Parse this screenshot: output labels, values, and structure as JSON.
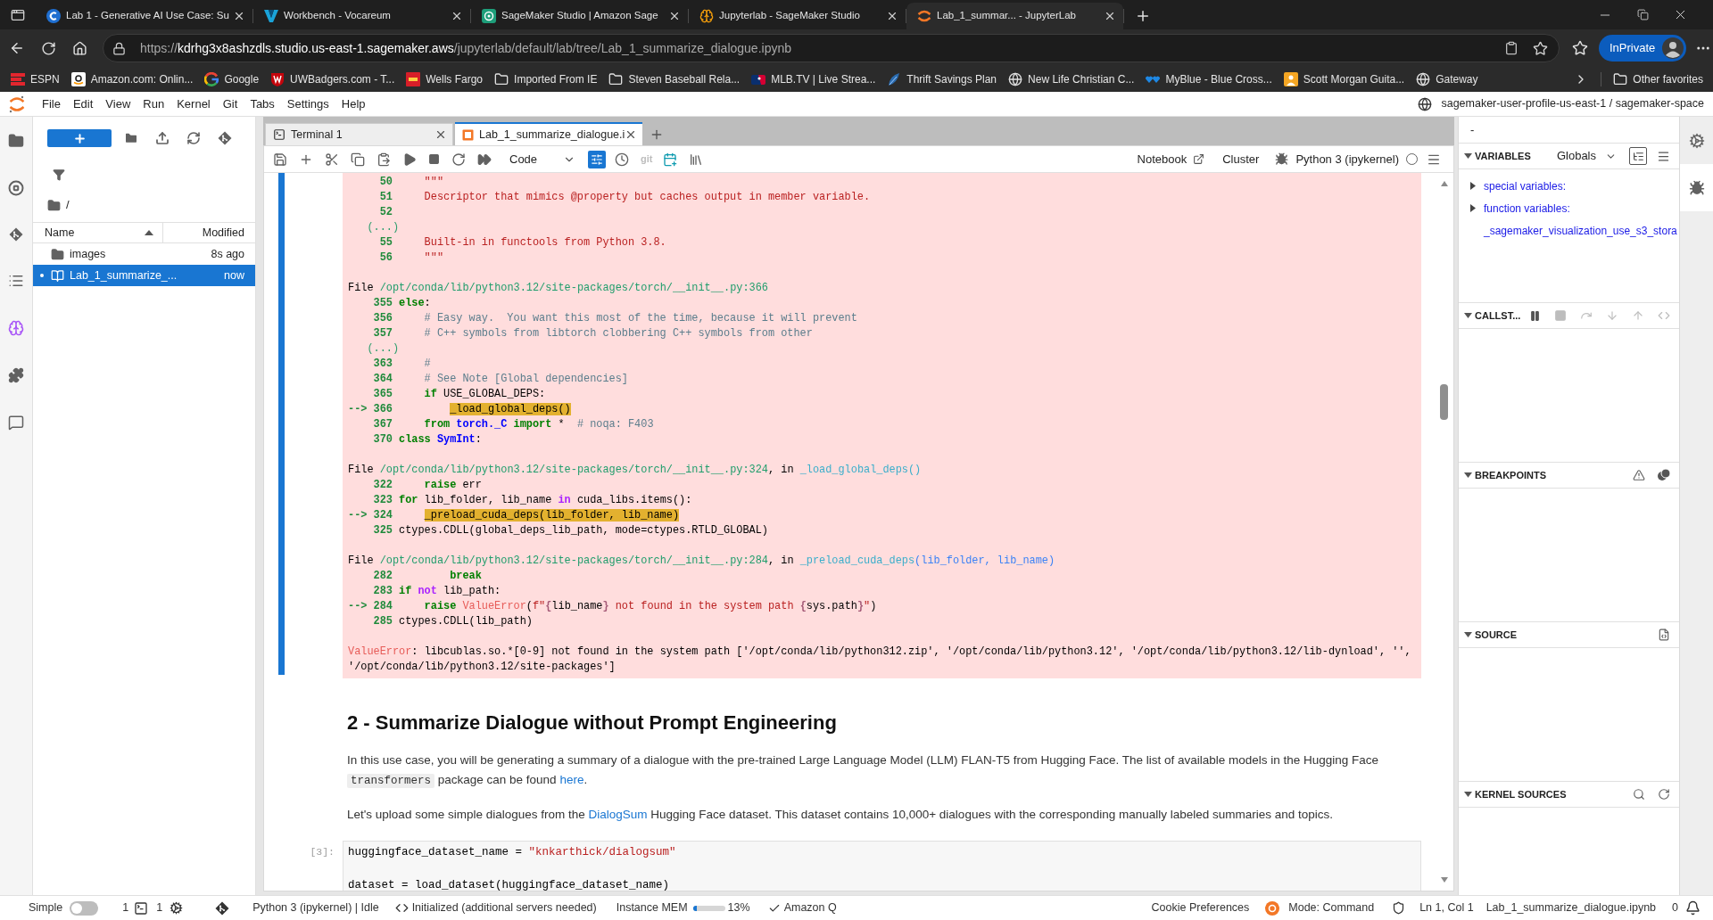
{
  "browser": {
    "tabs": [
      {
        "title": "Lab 1 - Generative AI Use Case: Su",
        "kind": "course",
        "selected": false
      },
      {
        "title": "Workbench - Vocareum",
        "kind": "workbench",
        "selected": false
      },
      {
        "title": "SageMaker Studio | Amazon Sage",
        "kind": "studio",
        "selected": false
      },
      {
        "title": "Jupyterlab - SageMaker Studio",
        "kind": "brain",
        "selected": false
      },
      {
        "title": "Lab_1_summar... - JupyterLab",
        "kind": "jupyter",
        "selected": true
      }
    ],
    "address": {
      "scheme": "https://",
      "host": "kdrhg3x8ashzdls.studio.us-east-1.sagemaker.aws",
      "path": "/jupyterlab/default/lab/tree/Lab_1_summarize_dialogue.ipynb"
    },
    "profile": "InPrivate",
    "bookmarks": [
      {
        "label": "ESPN",
        "kind": "espn"
      },
      {
        "label": "Amazon.com: Onlin...",
        "kind": "amazon"
      },
      {
        "label": "Google",
        "kind": "google"
      },
      {
        "label": "UWBadgers.com - T...",
        "kind": "badgers"
      },
      {
        "label": "Wells Fargo",
        "kind": "bank"
      },
      {
        "label": "Imported From IE",
        "kind": "folder"
      },
      {
        "label": "Steven Baseball Rela...",
        "kind": "folder"
      },
      {
        "label": "MLB.TV | Live Strea...",
        "kind": "mlb"
      },
      {
        "label": "Thrift Savings Plan",
        "kind": "tsp"
      },
      {
        "label": "New Life Christian C...",
        "kind": "globe"
      },
      {
        "label": "MyBlue - Blue Cross...",
        "kind": "hearts"
      },
      {
        "label": "Scott Morgan Guita...",
        "kind": "guitar"
      },
      {
        "label": "Gateway",
        "kind": "globe"
      }
    ],
    "other_favorites": "Other favorites"
  },
  "menu": {
    "items": [
      "File",
      "Edit",
      "View",
      "Run",
      "Kernel",
      "Git",
      "Tabs",
      "Settings",
      "Help"
    ],
    "space": "sagemaker-user-profile-us-east-1 / sagemaker-space"
  },
  "file_browser": {
    "breadcrumb": "/",
    "columns": [
      {
        "label": "Name",
        "sorted": true
      },
      {
        "label": "Modified",
        "sorted": false
      }
    ],
    "rows": [
      {
        "name": "images",
        "modified": "8s ago",
        "kind": "folder",
        "selected": false,
        "running": false
      },
      {
        "name": "Lab_1_summarize_...",
        "modified": "now",
        "kind": "notebook",
        "selected": true,
        "running": true
      }
    ]
  },
  "notebook": {
    "tabs": [
      {
        "label": "Terminal 1",
        "kind": "terminal",
        "selected": false
      },
      {
        "label": "Lab_1_summarize_dialogue.i",
        "kind": "notebook",
        "selected": true
      }
    ],
    "toolbar": {
      "cell_type": "Code",
      "panel_toggle": {
        "on": true
      },
      "git": "git",
      "notebook": "Notebook",
      "cluster": "Cluster",
      "kernel": "Python 3 (ipykernel)",
      "kernel_busy": false
    },
    "output": {
      "frames": [
        {
          "lines": [
            {
              "kind": "code",
              "num": "50",
              "code": [
                {
                  "kind": "str",
                  "text": "    \"\"\""
                }
              ]
            },
            {
              "kind": "code",
              "num": "51",
              "code": [
                {
                  "kind": "str",
                  "text": "    Descriptor that mimics @property but caches output in member variable."
                }
              ]
            },
            {
              "kind": "code",
              "num": "52"
            },
            {
              "kind": "ellipsis",
              "text": "(...)"
            },
            {
              "kind": "code",
              "num": "55",
              "code": [
                {
                  "kind": "str",
                  "text": "    Built-in in functools from Python 3.8."
                }
              ]
            },
            {
              "kind": "code",
              "num": "56",
              "code": [
                {
                  "kind": "str",
                  "text": "    \"\"\""
                }
              ]
            }
          ]
        },
        {
          "header": [
            {
              "kind": "plain",
              "text": "File "
            },
            {
              "kind": "path",
              "text": "/opt/conda/lib/python3.12/site-packages/torch/__init__.py:366"
            }
          ],
          "lines": [
            {
              "kind": "code",
              "num": "355",
              "code": [
                {
                  "kind": "kw",
                  "text": "else"
                },
                {
                  "kind": "plain",
                  "text": ":"
                }
              ]
            },
            {
              "kind": "code",
              "num": "356",
              "code": [
                {
                  "kind": "comment",
                  "text": "    # Easy way.  You want this most of the time, because it will prevent"
                }
              ]
            },
            {
              "kind": "code",
              "num": "357",
              "code": [
                {
                  "kind": "comment",
                  "text": "    # C++ symbols from libtorch clobbering C++ symbols from other"
                }
              ]
            },
            {
              "kind": "ellipsis",
              "text": "(...)"
            },
            {
              "kind": "code",
              "num": "363",
              "code": [
                {
                  "kind": "comment",
                  "text": "    #"
                }
              ]
            },
            {
              "kind": "code",
              "num": "364",
              "code": [
                {
                  "kind": "comment",
                  "text": "    # See Note [Global dependencies]"
                }
              ]
            },
            {
              "kind": "code",
              "num": "365",
              "code": [
                {
                  "kind": "kw",
                  "text": "    if"
                },
                {
                  "kind": "plain",
                  "text": " USE_GLOBAL_DEPS:"
                }
              ]
            },
            {
              "kind": "code",
              "marker": "-->",
              "num": "366",
              "code": [
                {
                  "kind": "hl",
                  "text": "        _load_global_deps()"
                }
              ]
            },
            {
              "kind": "code",
              "num": "367",
              "code": [
                {
                  "kind": "kw",
                  "text": "    from"
                },
                {
                  "kind": "mod",
                  "text": " torch._C"
                },
                {
                  "kind": "kw",
                  "text": " import"
                },
                {
                  "kind": "plain",
                  "text": " *  "
                },
                {
                  "kind": "comment",
                  "text": "# noqa: F403"
                }
              ]
            },
            {
              "kind": "code",
              "num": "370",
              "code": [
                {
                  "kind": "kw",
                  "text": "class"
                },
                {
                  "kind": "cls",
                  "text": " SymInt"
                },
                {
                  "kind": "plain",
                  "text": ":"
                }
              ]
            }
          ]
        },
        {
          "header": [
            {
              "kind": "plain",
              "text": "File "
            },
            {
              "kind": "path",
              "text": "/opt/conda/lib/python3.12/site-packages/torch/__init__.py:324"
            },
            {
              "kind": "plain",
              "text": ", in "
            },
            {
              "kind": "func",
              "text": "_load_global_deps()"
            }
          ],
          "lines": [
            {
              "kind": "code",
              "num": "322",
              "code": [
                {
                  "kind": "kw",
                  "text": "    raise"
                },
                {
                  "kind": "plain",
                  "text": " err"
                }
              ]
            },
            {
              "kind": "code",
              "num": "323",
              "code": [
                {
                  "kind": "kw",
                  "text": "for"
                },
                {
                  "kind": "plain",
                  "text": " lib_folder, lib_name "
                },
                {
                  "kind": "op",
                  "text": "in"
                },
                {
                  "kind": "plain",
                  "text": " cuda_libs.items():"
                }
              ]
            },
            {
              "kind": "code",
              "marker": "-->",
              "num": "324",
              "code": [
                {
                  "kind": "hl",
                  "text": "    _preload_cuda_deps(lib_folder, lib_name)"
                }
              ]
            },
            {
              "kind": "code",
              "num": "325",
              "code": [
                {
                  "kind": "plain",
                  "text": "ctypes.CDLL(global_deps_lib_path, mode=ctypes.RTLD_GLOBAL)"
                }
              ]
            }
          ]
        },
        {
          "header": [
            {
              "kind": "plain",
              "text": "File "
            },
            {
              "kind": "path",
              "text": "/opt/conda/lib/python3.12/site-packages/torch/__init__.py:284"
            },
            {
              "kind": "plain",
              "text": ", in "
            },
            {
              "kind": "func",
              "text": "_preload_cuda_deps"
            },
            {
              "kind": "args",
              "text": "(lib_folder, lib_name)"
            }
          ],
          "lines": [
            {
              "kind": "code",
              "num": "282",
              "code": [
                {
                  "kind": "kw",
                  "text": "        break"
                }
              ]
            },
            {
              "kind": "code",
              "num": "283",
              "code": [
                {
                  "kind": "kw",
                  "text": "if"
                },
                {
                  "kind": "op",
                  "text": " not"
                },
                {
                  "kind": "plain",
                  "text": " lib_path:"
                }
              ]
            },
            {
              "kind": "code",
              "marker": "-->",
              "num": "284",
              "code": [
                {
                  "kind": "kw",
                  "text": "    raise"
                },
                {
                  "kind": "err",
                  "text": " ValueError"
                },
                {
                  "kind": "plain",
                  "text": "("
                },
                {
                  "kind": "str",
                  "text": "f\""
                },
                {
                  "kind": "interp",
                  "text": "{"
                },
                {
                  "kind": "plain",
                  "text": "lib_name"
                },
                {
                  "kind": "interp",
                  "text": "}"
                },
                {
                  "kind": "str",
                  "text": " not found in the system path "
                },
                {
                  "kind": "interp",
                  "text": "{"
                },
                {
                  "kind": "plain",
                  "text": "sys.path"
                },
                {
                  "kind": "interp",
                  "text": "}"
                },
                {
                  "kind": "str",
                  "text": "\""
                },
                {
                  "kind": "plain",
                  "text": ")"
                }
              ]
            },
            {
              "kind": "code",
              "num": "285",
              "code": [
                {
                  "kind": "plain",
                  "text": "ctypes.CDLL(lib_path)"
                }
              ]
            }
          ]
        }
      ],
      "error": [
        {
          "kind": "err",
          "text": "ValueError"
        },
        {
          "kind": "plain",
          "text": ": libcublas.so.*[0-9] not found in the system path ['/opt/conda/lib/python312.zip', '/opt/conda/lib/python3.12', '/opt/conda/lib/python3.12/lib-dynload', '', '/opt/conda/lib/python3.12/site-packages']"
        }
      ]
    },
    "markdown": {
      "heading": "2 - Summarize Dialogue without Prompt Engineering",
      "paragraphs": [
        [
          {
            "kind": "text",
            "text": "In this use case, you will be generating a summary of a dialogue with the pre-trained Large Language Model (LLM) FLAN-T5 from Hugging Face. The list of available models in the Hugging Face "
          },
          {
            "kind": "code",
            "text": "transformers"
          },
          {
            "kind": "text",
            "text": " package can be found "
          },
          {
            "kind": "link",
            "text": "here"
          },
          {
            "kind": "text",
            "text": "."
          }
        ],
        [
          {
            "kind": "text",
            "text": "Let's upload some simple dialogues from the "
          },
          {
            "kind": "link",
            "text": "DialogSum"
          },
          {
            "kind": "text",
            "text": " Hugging Face dataset. This dataset contains 10,000+ dialogues with the corresponding manually labeled summaries and topics."
          }
        ]
      ]
    },
    "code_cell": {
      "prompt": "[3]:",
      "lines": [
        {
          "kind": "code",
          "segments": [
            {
              "kind": "plain",
              "text": "huggingface_dataset_name = "
            },
            {
              "kind": "str",
              "text": "\"knkarthick/dialogsum\""
            }
          ]
        },
        {
          "kind": "blank"
        },
        {
          "kind": "code",
          "segments": [
            {
              "kind": "plain",
              "text": "dataset = load_dataset(huggingface_dataset_name)"
            }
          ]
        }
      ]
    }
  },
  "debugger": {
    "title": "-",
    "sections": [
      {
        "kind": "variables",
        "title": "VARIABLES",
        "expanded": true,
        "scope": "Globals",
        "items": [
          {
            "label": "special variables:",
            "kind": "group"
          },
          {
            "label": "function variables:",
            "kind": "group"
          },
          {
            "label": "_sagemaker_visualization_use_s3_stora",
            "kind": "value"
          }
        ]
      },
      {
        "kind": "callstack",
        "title": "CALLST...",
        "expanded": true
      },
      {
        "kind": "breakpoints",
        "title": "BREAKPOINTS",
        "expanded": true
      },
      {
        "kind": "source",
        "title": "SOURCE",
        "expanded": true
      },
      {
        "kind": "kernel_sources",
        "title": "KERNEL SOURCES",
        "expanded": true
      }
    ]
  },
  "right_bar": {
    "items": [
      {
        "kind": "settings",
        "selected": false
      },
      {
        "kind": "debugger",
        "selected": true
      }
    ]
  },
  "status_bar": {
    "simple": {
      "label": "Simple",
      "on": false
    },
    "terminals": "1",
    "kernels": "1",
    "kernel": "Python 3 (ipykernel) | Idle",
    "servers": "Initialized (additional servers needed)",
    "memory": {
      "label": "Instance MEM",
      "level": 0.13,
      "reading": "13%"
    },
    "assistant": "Amazon Q",
    "cookies": "Cookie Preferences",
    "mode": "Mode: Command",
    "position": "Ln 1, Col 1",
    "file": "Lab_1_summarize_dialogue.ipynb",
    "notifications": "0"
  }
}
